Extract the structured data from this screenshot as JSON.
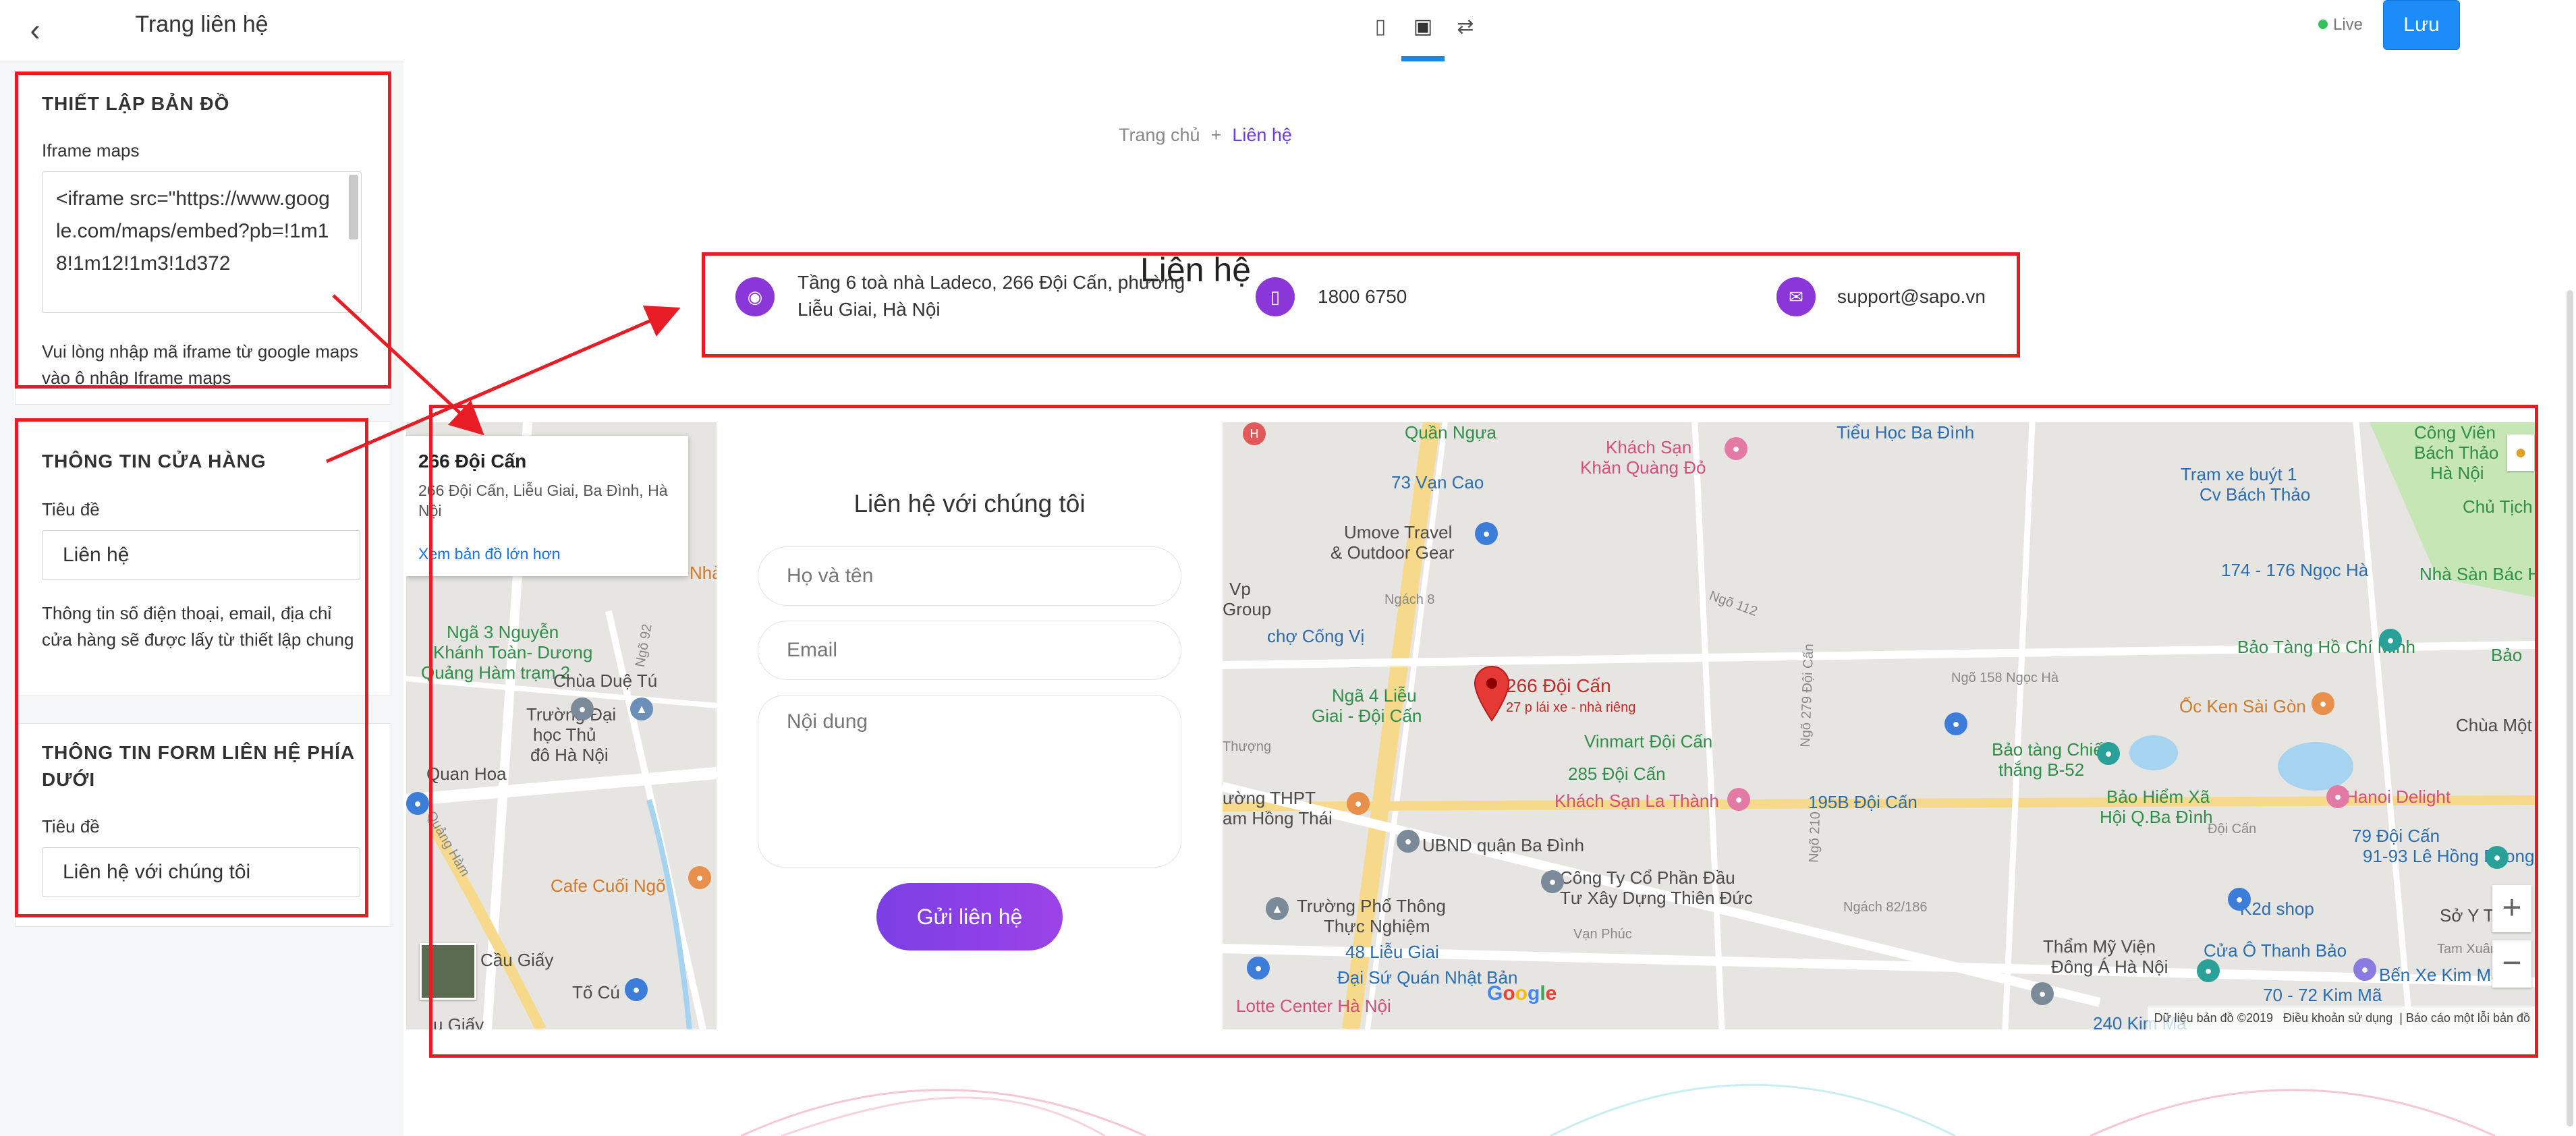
{
  "sidebar": {
    "title": "Trang liên hệ",
    "back_icon": "chevron-left-icon",
    "map_section": {
      "title": "THIẾT LẬP BẢN ĐỒ",
      "iframe_label": "Iframe maps",
      "iframe_value": "<iframe src=\"https://www.google.com/maps/embed?pb=!1m18!1m12!1m3!1d372",
      "help": "Vui lòng nhập mã iframe từ google maps vào ô nhập Iframe maps"
    },
    "store_section": {
      "title": "THÔNG TIN CỬA HÀNG",
      "title_label": "Tiêu đề",
      "title_value": "Liên hệ",
      "help": "Thông tin số điện thoại, email, địa chỉ cửa hàng sẽ được lấy từ thiết lập chung"
    },
    "form_section": {
      "title": "THÔNG TIN FORM LIÊN HỆ PHÍA DƯỚI",
      "title_label": "Tiêu đề",
      "title_value": "Liên hệ với chúng tôi"
    }
  },
  "topbar": {
    "devices": [
      "mobile-icon",
      "desktop-icon",
      "fullwidth-icon"
    ],
    "live_label": "Live",
    "save_label": "Lưu"
  },
  "preview": {
    "breadcrumb": {
      "home": "Trang chủ",
      "sep": "+",
      "current": "Liên hệ"
    },
    "page_title": "Liên hệ",
    "info": {
      "address": "Tầng 6 toà nhà Ladeco, 266 Đội Cấn, phường Liễu Giai, Hà Nội",
      "phone": "1800 6750",
      "email": "support@sapo.vn"
    },
    "map_popup": {
      "name": "266 Đội Cấn",
      "address": "266 Đội Cấn, Liễu Giai, Ba Đình, Hà Nội",
      "link": "Xem bản đồ lớn hơn"
    },
    "form": {
      "title": "Liên hệ với chúng tôi",
      "name_placeholder": "Họ và tên",
      "email_placeholder": "Email",
      "content_placeholder": "Nội dung",
      "submit": "Gửi liên hệ"
    },
    "map_labels_left": [
      "Quần Ngựa",
      "Nhà",
      "Ngã 3 Nguyễn",
      "Khánh Toàn- Dương",
      "Quảng Hàm trạm 2",
      "Ngõ 92",
      "Chùa Duệ Tú",
      "Trường Đại",
      "học Thủ",
      "đô Hà Nội",
      "Quan Hoa",
      "Quảng Hàm",
      "Cafe Cuối Ngõ",
      "Cầu Giấy",
      "Tố Cú",
      "u Giấy"
    ],
    "map_labels_right": [
      "Quần Ngựa",
      "Khách Sạn",
      "Khăn Quàng Đỏ",
      "Tiểu Học Ba Đình",
      "73 Vạn Cao",
      "Umove Travel",
      "& Outdoor Gear",
      "Ngách 8",
      "Vp",
      "Group",
      "chợ Cống Vị",
      "Ngõ 112",
      "Ngõ 279 Đội Cấn",
      "Ngõ 158 Ngọc Hà",
      "Ngã 4 Liễu",
      "Giai - Đội Cấn",
      "266 Đội Cấn",
      "27 p lái xe - nhà riêng",
      "Vinmart Đội Cấn",
      "285 Đội Cấn",
      "Khách Sạn La Thành",
      "Thượng",
      "ường THPT",
      "am Hồng Thái",
      "UBND quận Ba Đình",
      "Ngõ 210",
      "195B Đội Cấn",
      "Công Ty Cổ Phần Đầu",
      "Tư Xây Dựng Thiên Đức",
      "Trường Phổ Thông",
      "Thực Nghiệm",
      "Vạn Phúc",
      "Ngách 82/186",
      "48 Liễu Giai",
      "Đại Sứ Quán Nhật Bản",
      "Lotte Center Hà Nội",
      "Trạm xe buýt 1",
      "Cv Bách Thảo",
      "174 - 176 Ngọc Hà",
      "Nhà Sàn Bác Hồ",
      "Bảo Tàng Hồ Chí Minh",
      "Ốc Ken Sài Gòn",
      "Bảo tàng Chiến",
      "thắng B-52",
      "Bảo Hiểm Xã",
      "Hội Q.Ba Đình",
      "Đội Cấn",
      "Hanoi Delight",
      "Đội Cấn",
      "79 Đội Cấn",
      "91-93 Lê Hồng Phong",
      "Sở Y Tế",
      "K2d shop",
      "Cửa Ô Thanh Bảo",
      "Thẩm Mỹ Viện",
      "Đông Á Hà Nội",
      "Tam Xuân",
      "Bến Xe Kim Mã",
      "70 - 72 Kim Mã",
      "240 Kim Mã",
      "Công Viên",
      "Bách Thảo",
      "Hà Nội",
      "Chủ Tịch",
      "Chùa Một",
      "Bảo"
    ],
    "map_footer": [
      "Dữ liệu bản đồ ©2019",
      "Điều khoản sử dụng",
      "Báo cáo một lỗi bản đồ"
    ],
    "google_logo": "Google",
    "zoom_in": "+",
    "zoom_out": "−"
  },
  "colors": {
    "accent": "#8a36d9",
    "save": "#1d8cf8",
    "annotation": "#e81c24",
    "link": "#6a3be0"
  }
}
